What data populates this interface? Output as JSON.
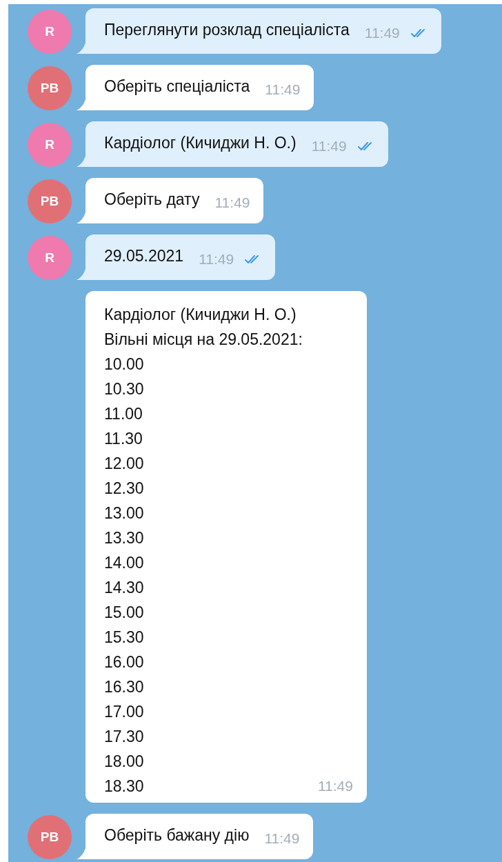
{
  "messages": [
    {
      "kind": "outgoing",
      "avatar": {
        "initials": "R",
        "color": "#ee7aae"
      },
      "lines": [
        "Переглянути розклад спеціаліста"
      ],
      "time": "11:49",
      "read": true
    },
    {
      "kind": "incoming",
      "avatar": {
        "initials": "РВ",
        "color": "#e17076"
      },
      "lines": [
        "Оберіть спеціаліста"
      ],
      "time": "11:49"
    },
    {
      "kind": "outgoing",
      "avatar": {
        "initials": "R",
        "color": "#ee7aae"
      },
      "lines": [
        "Кардіолог (Кичиджи Н. О.)"
      ],
      "time": "11:49",
      "read": true
    },
    {
      "kind": "incoming",
      "avatar": {
        "initials": "РВ",
        "color": "#e17076"
      },
      "lines": [
        "Оберіть дату"
      ],
      "time": "11:49"
    },
    {
      "kind": "outgoing",
      "avatar": {
        "initials": "R",
        "color": "#ee7aae"
      },
      "lines": [
        "29.05.2021"
      ],
      "time": "11:49",
      "read": true
    },
    {
      "kind": "incoming",
      "lines": [
        "Кардіолог (Кичиджи Н. О.)",
        "Вільні місця на 29.05.2021:",
        "10.00",
        "10.30",
        "11.00",
        "11.30",
        "12.00",
        "12.30",
        "13.00",
        "13.30",
        "14.00",
        "14.30",
        "15.00",
        "15.30",
        "16.00",
        "16.30",
        "17.00",
        "17.30",
        "18.00",
        "18.30"
      ],
      "time": "11:49"
    },
    {
      "kind": "incoming",
      "avatar": {
        "initials": "РВ",
        "color": "#e17076"
      },
      "lines": [
        "Оберіть бажану дію"
      ],
      "time": "11:49"
    }
  ]
}
